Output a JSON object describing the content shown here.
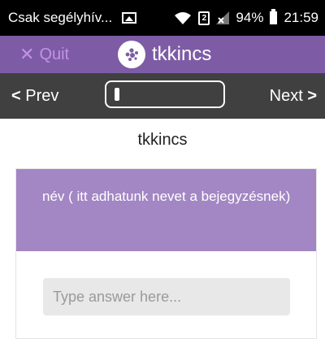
{
  "status_bar": {
    "carrier": "Csak segélyhív...",
    "battery": "94%",
    "time": "21:59"
  },
  "title_bar": {
    "quit_icon": "close-icon",
    "quit_label": "Quit",
    "brand_icon": "dots-logo-icon",
    "brand_name": "tkkincs"
  },
  "nav": {
    "prev_label": "Prev",
    "next_label": "Next",
    "progress_fraction": 0.04
  },
  "page_title": "tkkincs",
  "question": {
    "text": "név ( itt adhatunk nevet a bejegyzésnek)"
  },
  "answer": {
    "value": "",
    "placeholder": "Type answer here..."
  },
  "colors": {
    "primary": "#7d5ca5",
    "question_header": "#a386c4",
    "quit": "#c491e6",
    "nav_bar": "#404040"
  }
}
